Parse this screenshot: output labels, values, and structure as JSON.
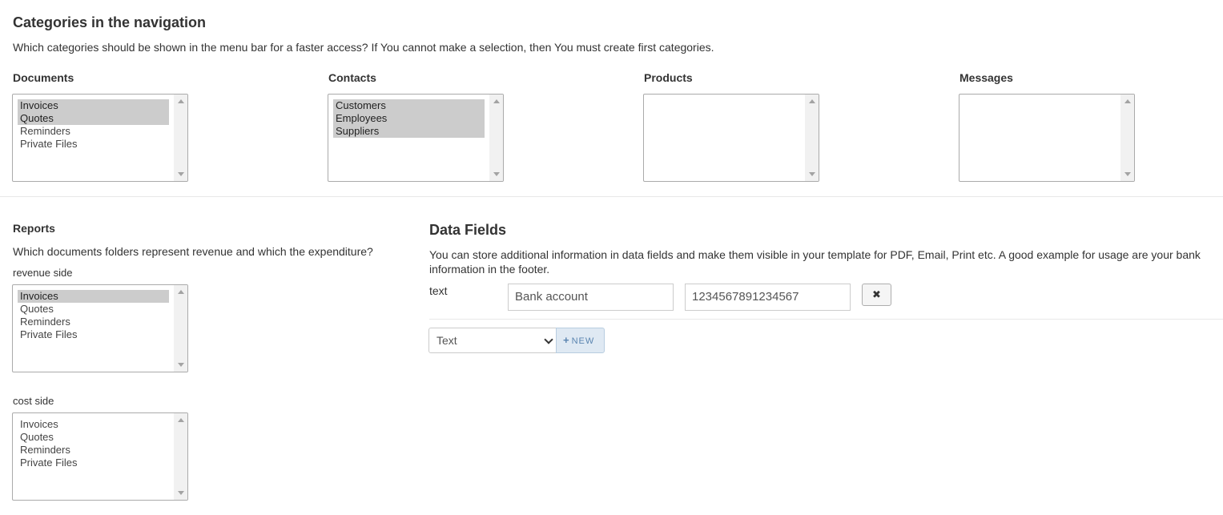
{
  "nav_categories": {
    "title": "Categories in the navigation",
    "description": "Which categories should be shown in the menu bar for a faster access? If You cannot make a selection, then You must create first categories.",
    "documents": {
      "label": "Documents",
      "options": [
        {
          "text": "Invoices",
          "selected": true
        },
        {
          "text": "Quotes",
          "selected": true
        },
        {
          "text": "Reminders",
          "selected": false
        },
        {
          "text": "Private Files",
          "selected": false
        }
      ]
    },
    "contacts": {
      "label": "Contacts",
      "options": [
        {
          "text": "Customers",
          "selected": true
        },
        {
          "text": "Employees",
          "selected": true
        },
        {
          "text": "Suppliers",
          "selected": true
        }
      ]
    },
    "products": {
      "label": "Products",
      "options": []
    },
    "messages": {
      "label": "Messages",
      "options": []
    }
  },
  "reports": {
    "title": "Reports",
    "description": "Which documents folders represent revenue and which the expenditure?",
    "revenue_label": "revenue side",
    "revenue_options": [
      {
        "text": "Invoices",
        "selected": true
      },
      {
        "text": "Quotes",
        "selected": false
      },
      {
        "text": "Reminders",
        "selected": false
      },
      {
        "text": "Private Files",
        "selected": false
      }
    ],
    "cost_label": "cost side",
    "cost_options": [
      {
        "text": "Invoices",
        "selected": false
      },
      {
        "text": "Quotes",
        "selected": false
      },
      {
        "text": "Reminders",
        "selected": false
      },
      {
        "text": "Private Files",
        "selected": false
      }
    ]
  },
  "data_fields": {
    "title": "Data Fields",
    "description": "You can store additional information in data fields and make them visible in your template for PDF, Email, Print etc. A good example for usage are your bank information in the footer.",
    "rows": [
      {
        "type_label": "text",
        "name": "Bank account",
        "value": "1234567891234567",
        "remove_icon": "close-icon"
      }
    ],
    "type_select_value": "Text",
    "new_button_label": "NEW",
    "new_button_icon": "plus-icon",
    "accent_color": "#5b85b0"
  }
}
